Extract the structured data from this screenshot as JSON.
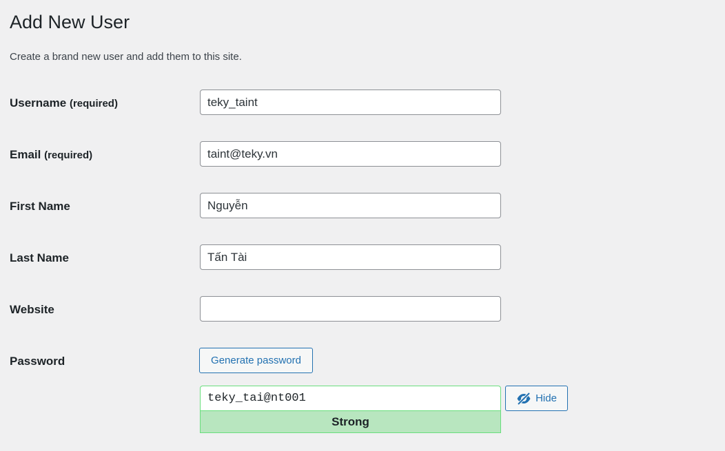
{
  "page": {
    "title": "Add New User",
    "subtitle": "Create a brand new user and add them to this site."
  },
  "form": {
    "username": {
      "label": "Username",
      "required": "(required)",
      "value": "teky_taint"
    },
    "email": {
      "label": "Email",
      "required": "(required)",
      "value": "taint@teky.vn"
    },
    "first_name": {
      "label": "First Name",
      "value": "Nguyễn"
    },
    "last_name": {
      "label": "Last Name",
      "value": "Tấn Tài"
    },
    "website": {
      "label": "Website",
      "value": ""
    },
    "password": {
      "label": "Password",
      "generate_label": "Generate password",
      "value": "teky_tai@nt001",
      "strength": "Strong",
      "hide_label": "Hide",
      "hide_icon": "eye-slash-icon"
    }
  },
  "colors": {
    "background": "#f0f0f1",
    "accent": "#2271b1",
    "strength_bg": "#b8e6bf",
    "strength_border": "#68de7c"
  }
}
